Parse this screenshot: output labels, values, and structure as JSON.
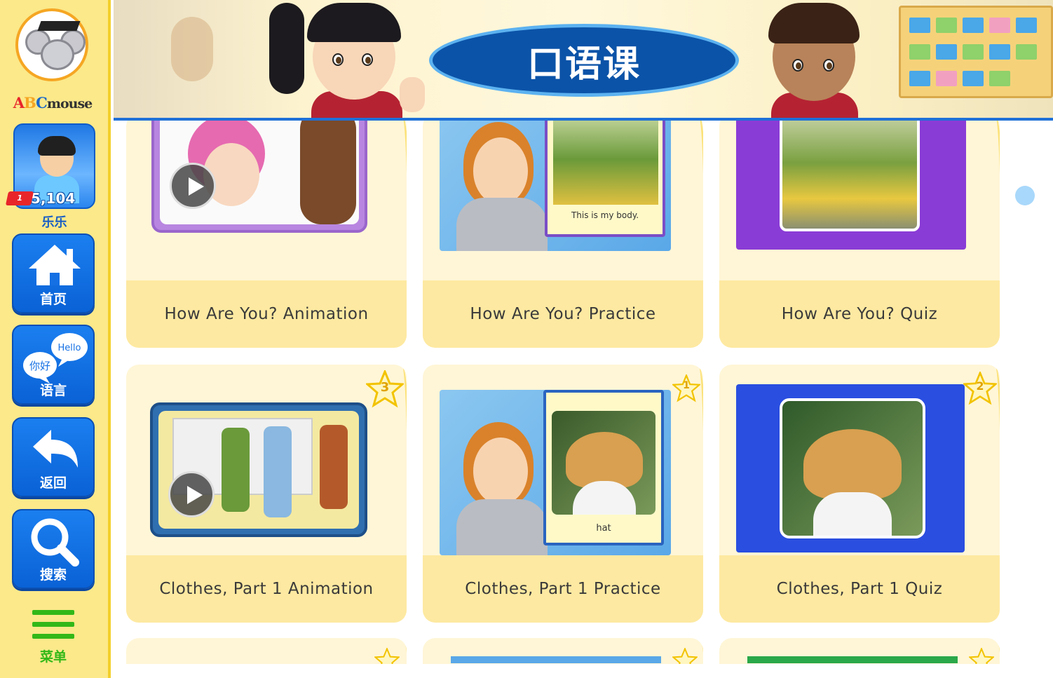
{
  "brand": {
    "logo_text_a": "A",
    "logo_text_b": "B",
    "logo_text_c": "C",
    "logo_text_m": "mouse"
  },
  "user": {
    "badge": "1",
    "points": "5,104",
    "name": "乐乐"
  },
  "nav": {
    "home": "首页",
    "language": "语言",
    "back": "返回",
    "search": "搜索",
    "menu": "菜单"
  },
  "language_icon": {
    "bubble_en": "Hello",
    "bubble_zh": "你好"
  },
  "header": {
    "title": "口语课"
  },
  "cards": [
    {
      "caption": "How Are You? Animation",
      "type": "animation",
      "star": null
    },
    {
      "caption": "How Are You? Practice",
      "type": "practice",
      "star": null,
      "book_caption": "This is my body."
    },
    {
      "caption": "How Are You? Quiz",
      "type": "quiz",
      "star": null
    },
    {
      "caption": "Clothes, Part 1 Animation",
      "type": "animation",
      "star": "3"
    },
    {
      "caption": "Clothes, Part 1 Practice",
      "type": "practice",
      "star": "1",
      "book_caption": "hat"
    },
    {
      "caption": "Clothes, Part 1 Quiz",
      "type": "quiz",
      "star": "2"
    }
  ],
  "colors": {
    "sidebar_bg": "#fbe98a",
    "nav_button": "#0a62d6",
    "menu_green": "#32b818",
    "title_oval": "#0b53a8",
    "card_caption_bg": "#fde9a1",
    "card_bg": "#fff6d7"
  },
  "icons": [
    "home-icon",
    "language-icon",
    "back-icon",
    "search-icon",
    "menu-icon",
    "play-icon",
    "star-icon"
  ]
}
